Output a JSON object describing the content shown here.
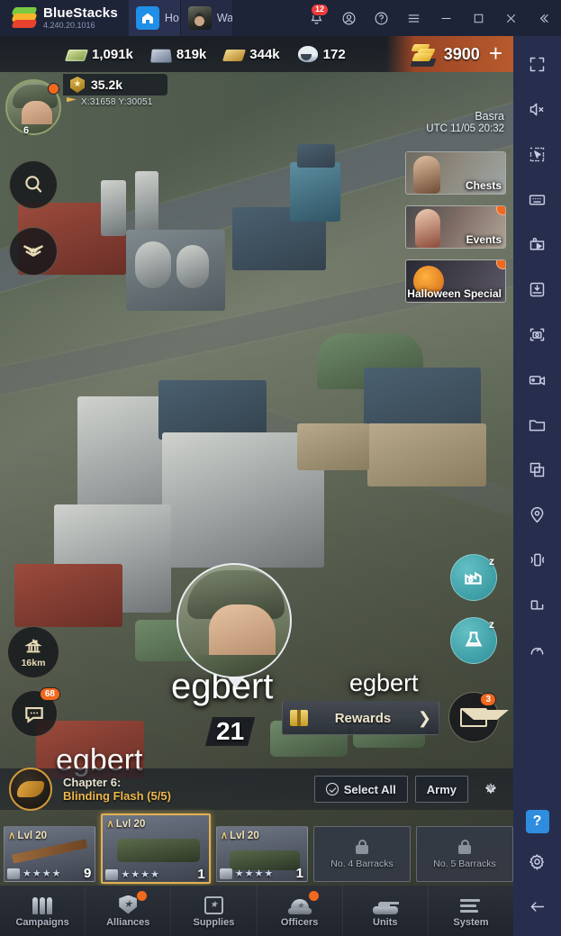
{
  "titlebar": {
    "app_name": "BlueStacks",
    "version": "4.240.20.1016",
    "tabs": [
      {
        "label": "Ho",
        "icon": "home-icon"
      },
      {
        "label": "Wa",
        "icon": "game-icon"
      }
    ],
    "notification_badge": "12",
    "icons": [
      "bell-icon",
      "account-icon",
      "help-icon",
      "menu-icon",
      "minimize-icon",
      "maximize-icon",
      "close-icon",
      "collapse-icon"
    ]
  },
  "game": {
    "resources": [
      {
        "name": "cash",
        "value": "1,091k"
      },
      {
        "name": "steel",
        "value": "819k"
      },
      {
        "name": "oil",
        "value": "344k"
      },
      {
        "name": "manpower",
        "value": "172"
      }
    ],
    "gold": {
      "value": "3900",
      "plus_label": "+"
    },
    "player": {
      "avatar_level": "6",
      "power": "35.2k",
      "coords": "X:31658 Y:30051",
      "name": "egbert",
      "name_secondary": "egbert",
      "name_tertiary": "egbert",
      "level_badge": "21"
    },
    "location": {
      "city": "Basra",
      "time": "UTC  11/05 20:32"
    },
    "left_buttons": [
      {
        "name": "search-button",
        "icon": "magnifier-icon"
      },
      {
        "name": "rank-button",
        "icon": "insignia-icon"
      }
    ],
    "base_button": {
      "label": "16km",
      "icon": "capitol-icon"
    },
    "chat_button": {
      "badge": "68",
      "icon": "chat-bubble-icon"
    },
    "idle_buttons": [
      {
        "name": "factory-idle-button",
        "icon": "factory-zzz-icon",
        "zzz": "z"
      },
      {
        "name": "research-idle-button",
        "icon": "flask-zzz-icon",
        "zzz": "z"
      }
    ],
    "event_cards": [
      {
        "label": "Chests",
        "has_badge": false
      },
      {
        "label": "Events",
        "has_badge": true
      },
      {
        "label": "Halloween Special",
        "has_badge": true
      }
    ],
    "rewards": {
      "label": "Rewards",
      "chevron": "❯"
    },
    "mail": {
      "badge": "3"
    },
    "chapter": {
      "title": "Chapter 6:",
      "subtitle": "Blinding Flash (5/5)"
    },
    "chapter_buttons": {
      "select_all": "Select All",
      "army": "Army"
    },
    "units": [
      {
        "level": "Lvl 20",
        "stars": 4,
        "count": "9",
        "type": "rifle",
        "selected": false,
        "locked": false
      },
      {
        "level": "Lvl 20",
        "stars": 4,
        "count": "1",
        "type": "tank1",
        "selected": true,
        "locked": false
      },
      {
        "level": "Lvl 20",
        "stars": 4,
        "count": "1",
        "type": "tank2",
        "selected": false,
        "locked": false
      },
      {
        "locked": true,
        "lock_label": "No. 4 Barracks"
      },
      {
        "locked": true,
        "lock_label": "No. 5 Barracks"
      }
    ],
    "nav": [
      {
        "label": "Campaigns",
        "icon": "shells-icon",
        "badge": false
      },
      {
        "label": "Alliances",
        "icon": "shield-icon",
        "badge": true
      },
      {
        "label": "Supplies",
        "icon": "crate-icon",
        "badge": false
      },
      {
        "label": "Officers",
        "icon": "cap-icon",
        "badge": true
      },
      {
        "label": "Units",
        "icon": "tank-icon",
        "badge": false
      },
      {
        "label": "System",
        "icon": "list-icon",
        "badge": false
      }
    ]
  },
  "sidebar": {
    "items": [
      "fullscreen-icon",
      "mute-icon",
      "cursor-select-icon",
      "keyboard-icon",
      "macro-play-icon",
      "apk-install-icon",
      "screenshot-icon",
      "record-icon",
      "folder-icon",
      "multi-instance-icon",
      "location-icon",
      "shake-icon",
      "rotate-icon",
      "eco-mode-icon"
    ],
    "help_label": "?",
    "bottom": [
      "settings-icon",
      "back-icon"
    ]
  }
}
